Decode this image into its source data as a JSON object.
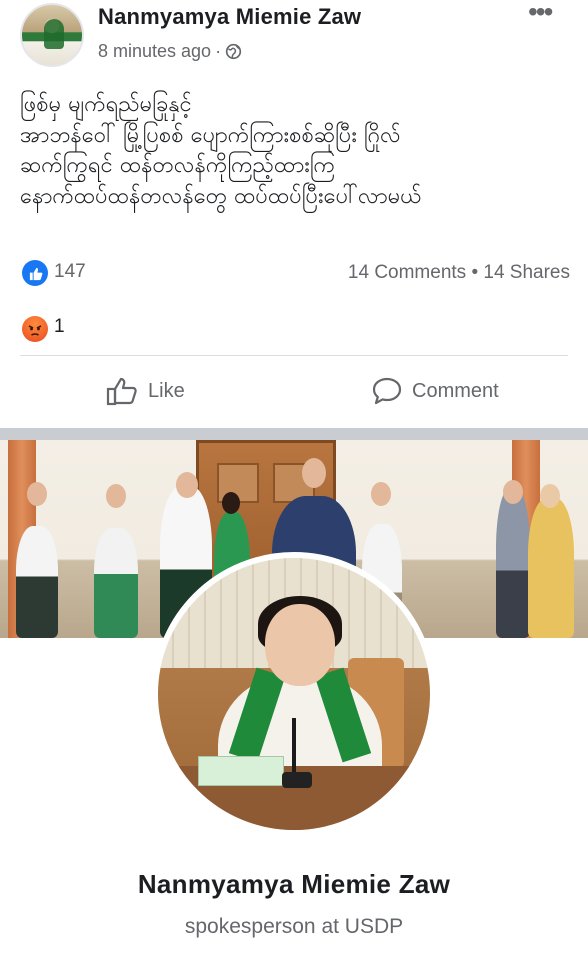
{
  "post": {
    "author": "Nanmyamya Miemie Zaw",
    "time": "8 minutes ago",
    "separator": "·",
    "text_lines": [
      "ဖြစ်မှ မျက်ရည်မခြုနှင့်",
      "အာဘန်ဝေါ် မြို့ပြစစ် ပျောက်ကြားစစ်ဆိုပြီး ဂြိုလ်",
      "ဆက်ကြွရင် ထန်တလန်ကိုကြည့်ထားကြ",
      "နောက်ထပ်ထန်တလန်တွေ ထပ်ထပ်ပြီးပေါ်လာမယ်"
    ]
  },
  "reactions": {
    "like_count": "147",
    "comments_shares": "14 Comments • 14 Shares",
    "angry_count": "1"
  },
  "actions": {
    "like_label": "Like",
    "comment_label": "Comment"
  },
  "profile": {
    "name": "Nanmyamya Miemie Zaw",
    "subtitle": "spokesperson at USDP"
  },
  "colors": {
    "facebook_blue": "#1877f2",
    "angry_orange": "#f0602b",
    "text_secondary": "#65676b"
  },
  "icons": {
    "globe": "globe-icon",
    "more": "more-dots-icon",
    "like": "thumbs-up-icon",
    "comment": "speech-bubble-icon",
    "angry": "angry-face-icon"
  }
}
